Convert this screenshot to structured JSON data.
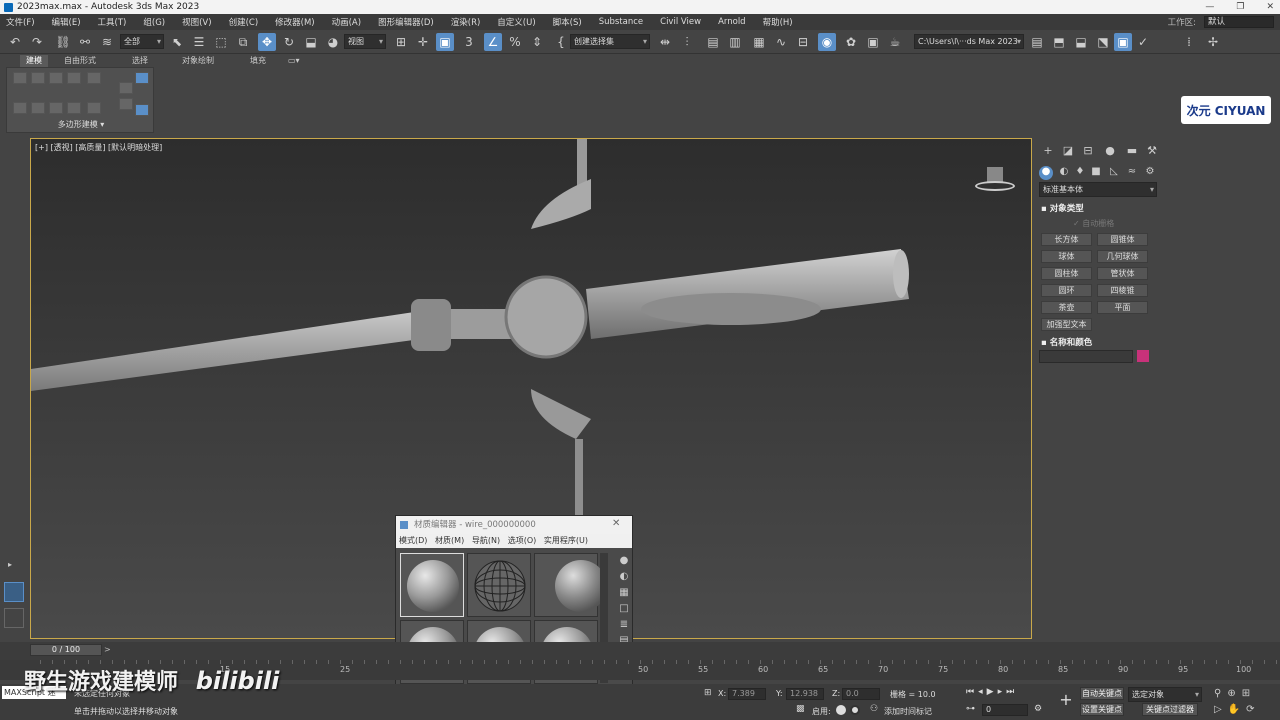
{
  "window": {
    "title": "2023max.max - Autodesk 3ds Max 2023",
    "controls": [
      "—",
      "❐",
      "✕"
    ]
  },
  "menu": [
    "文件(F)",
    "编辑(E)",
    "工具(T)",
    "组(G)",
    "视图(V)",
    "创建(C)",
    "修改器(M)",
    "动画(A)",
    "图形编辑器(D)",
    "渲染(R)",
    "自定义(U)",
    "脚本(S)",
    "Substance",
    "Civil View",
    "Arnold",
    "帮助(H)"
  ],
  "workspace": {
    "label": "工作区:",
    "value": "默认"
  },
  "toolbar": {
    "selection_filter": "全部",
    "ref_coord": "视图",
    "snap_label": "3",
    "named_selection": "创建选择集",
    "project_path": "C:\\Users\\l\\···ds Max 2023"
  },
  "ribbon": {
    "tabs": [
      "建模",
      "自由形式",
      "选择",
      "对象绘制",
      "填充"
    ],
    "panel_label": "多边形建模 ▾"
  },
  "logo": {
    "text": "次元 CIYUAN"
  },
  "viewport": {
    "label": "[+] [透视] [高质量] [默认明暗处理]"
  },
  "command_panel": {
    "category": "标准基本体",
    "object_type_title": "对象类型",
    "auto_grid": "自动栅格",
    "primitives": [
      "长方体",
      "圆锥体",
      "球体",
      "几何球体",
      "圆柱体",
      "管状体",
      "圆环",
      "四棱锥",
      "茶壶",
      "平面",
      "加强型文本"
    ],
    "name_color_title": "名称和颜色",
    "object_color": "#c8327a"
  },
  "material_editor": {
    "title": "材质编辑器 - wire_000000000",
    "menu": [
      "模式(D)",
      "材质(M)",
      "导航(N)",
      "选项(O)",
      "实用程序(U)"
    ]
  },
  "timeline": {
    "frame": "0 / 100",
    "ticks": [
      "15",
      "25",
      "50",
      "55",
      "60",
      "65",
      "70",
      "75",
      "80",
      "85",
      "90",
      "95",
      "100"
    ]
  },
  "status": {
    "maxscript": "MAXScript 迷",
    "line1": "未选定任何对象",
    "line2": "单击并拖动以选择并移动对象",
    "x_label": "X:",
    "x": "7.389",
    "y_label": "Y:",
    "y": "12.938",
    "z_label": "Z:",
    "z": "0.0",
    "grid": "栅格 = 10.0",
    "enable": "启用:",
    "add_time_tag": "添加时间标记",
    "auto_key": "自动关键点",
    "selected_object": "选定对象",
    "set_key": "设置关键点",
    "key_filters": "关键点过滤器",
    "frame_field": "0"
  },
  "watermark": {
    "channel": "野生游戏建模师",
    "site": "bilibili"
  }
}
